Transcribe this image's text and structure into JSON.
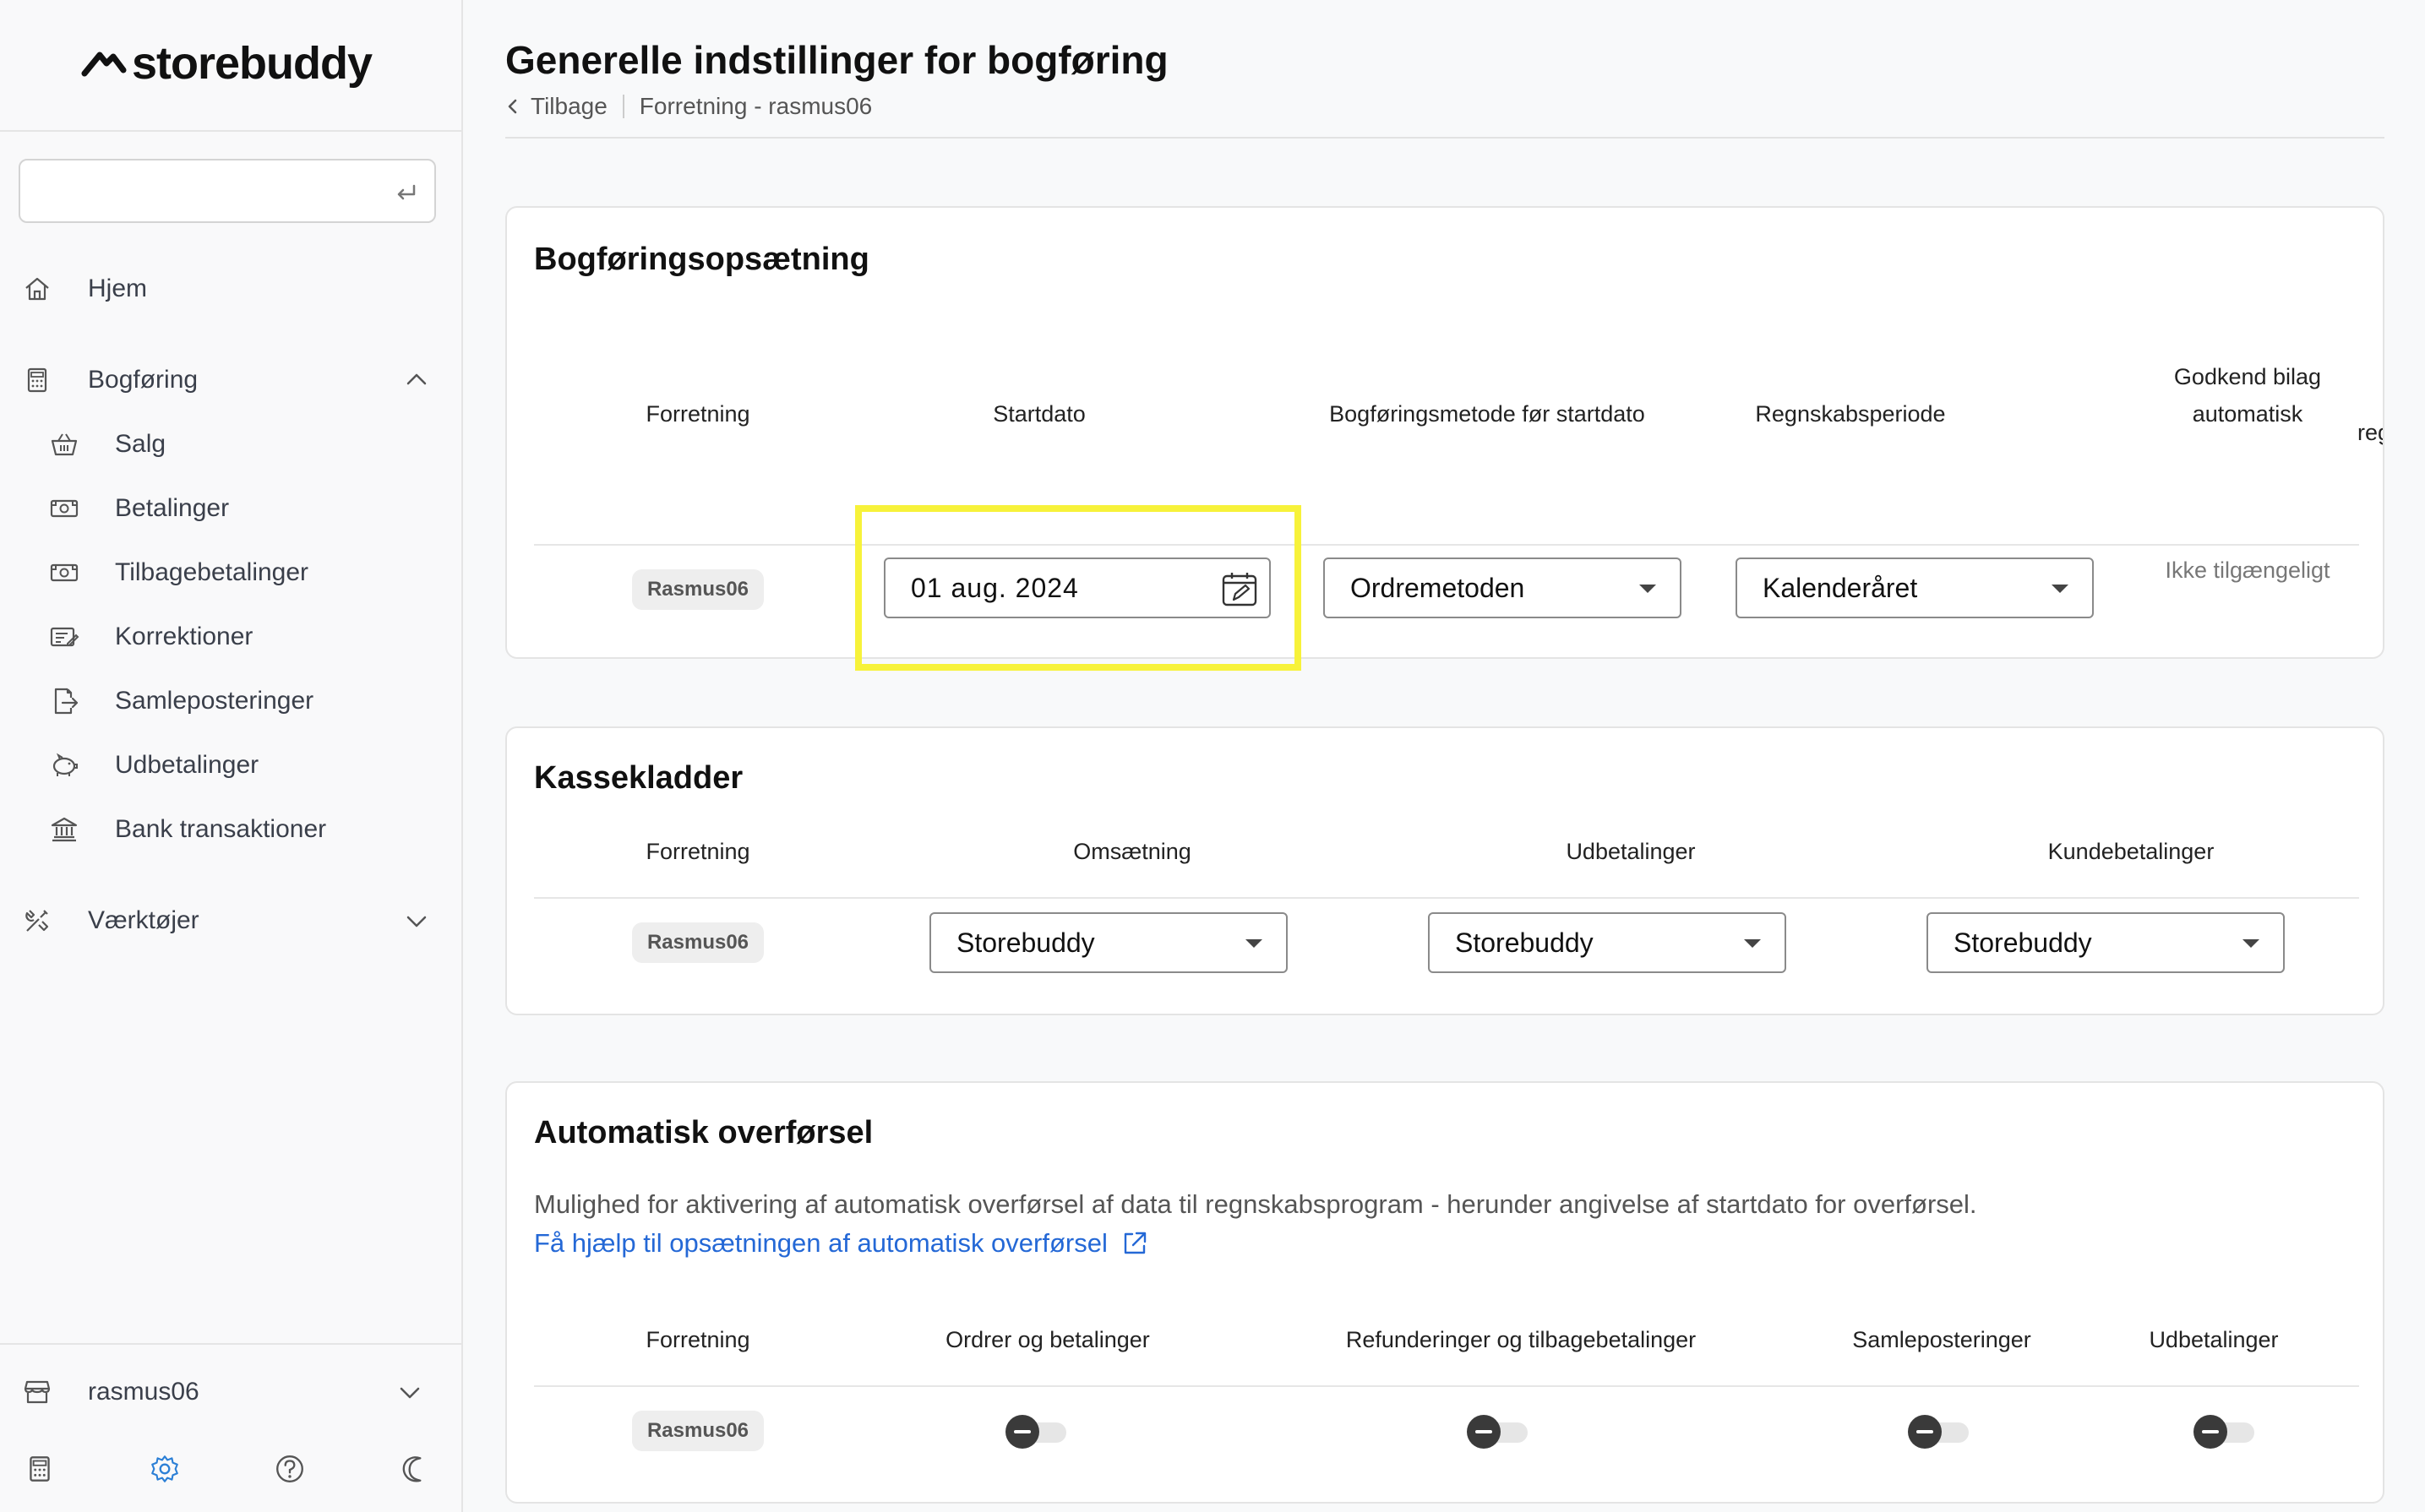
{
  "brand": {
    "name": "storebuddy"
  },
  "sidebar": {
    "search_placeholder": "",
    "items": [
      {
        "label": "Hjem",
        "icon": "home-icon"
      },
      {
        "label": "Bogføring",
        "icon": "calculator-icon",
        "expanded": true
      },
      {
        "label": "Salg",
        "icon": "basket-icon"
      },
      {
        "label": "Betalinger",
        "icon": "cash-icon"
      },
      {
        "label": "Tilbagebetalinger",
        "icon": "cash-icon"
      },
      {
        "label": "Korrektioner",
        "icon": "edit-doc-icon"
      },
      {
        "label": "Samleposteringer",
        "icon": "export-doc-icon"
      },
      {
        "label": "Udbetalinger",
        "icon": "piggy-bank-icon"
      },
      {
        "label": "Bank transaktioner",
        "icon": "bank-icon"
      },
      {
        "label": "Værktøjer",
        "icon": "tools-icon",
        "expanded": false
      }
    ],
    "store": {
      "label": "rasmus06",
      "icon": "store-icon"
    }
  },
  "header": {
    "title": "Generelle indstillinger for bogføring",
    "back_label": "Tilbage",
    "breadcrumb": "Forretning - rasmus06"
  },
  "setup_card": {
    "title": "Bogføringsopsætning",
    "columns": [
      "Forretning",
      "Startdato",
      "Bogføringsmetode før startdato",
      "Regnskabsperiode",
      "Godkend bilag automatisk",
      "reg"
    ],
    "row": {
      "shop": "Rasmus06",
      "start_date": "01 aug. 2024",
      "method": "Ordremetoden",
      "period": "Kalenderåret",
      "auto_approve": "Ikke tilgængeligt"
    }
  },
  "cash_card": {
    "title": "Kassekladder",
    "columns": [
      "Forretning",
      "Omsætning",
      "Udbetalinger",
      "Kundebetalinger"
    ],
    "row": {
      "shop": "Rasmus06",
      "revenue": "Storebuddy",
      "payouts": "Storebuddy",
      "customer_payments": "Storebuddy"
    }
  },
  "auto_card": {
    "title": "Automatisk overførsel",
    "description": "Mulighed for aktivering af automatisk overførsel af data til regnskabsprogram - herunder angivelse af startdato for overførsel.",
    "help_link": "Få hjælp til opsætningen af automatisk overførsel",
    "columns": [
      "Forretning",
      "Ordrer og betalinger",
      "Refunderinger og tilbagebetalinger",
      "Samleposteringer",
      "Udbetalinger"
    ],
    "row": {
      "shop": "Rasmus06",
      "toggles": [
        false,
        false,
        false,
        false
      ]
    }
  },
  "colors": {
    "highlight": "#f7f23a",
    "link": "#2468d6",
    "accent": "#2b7fd6"
  }
}
